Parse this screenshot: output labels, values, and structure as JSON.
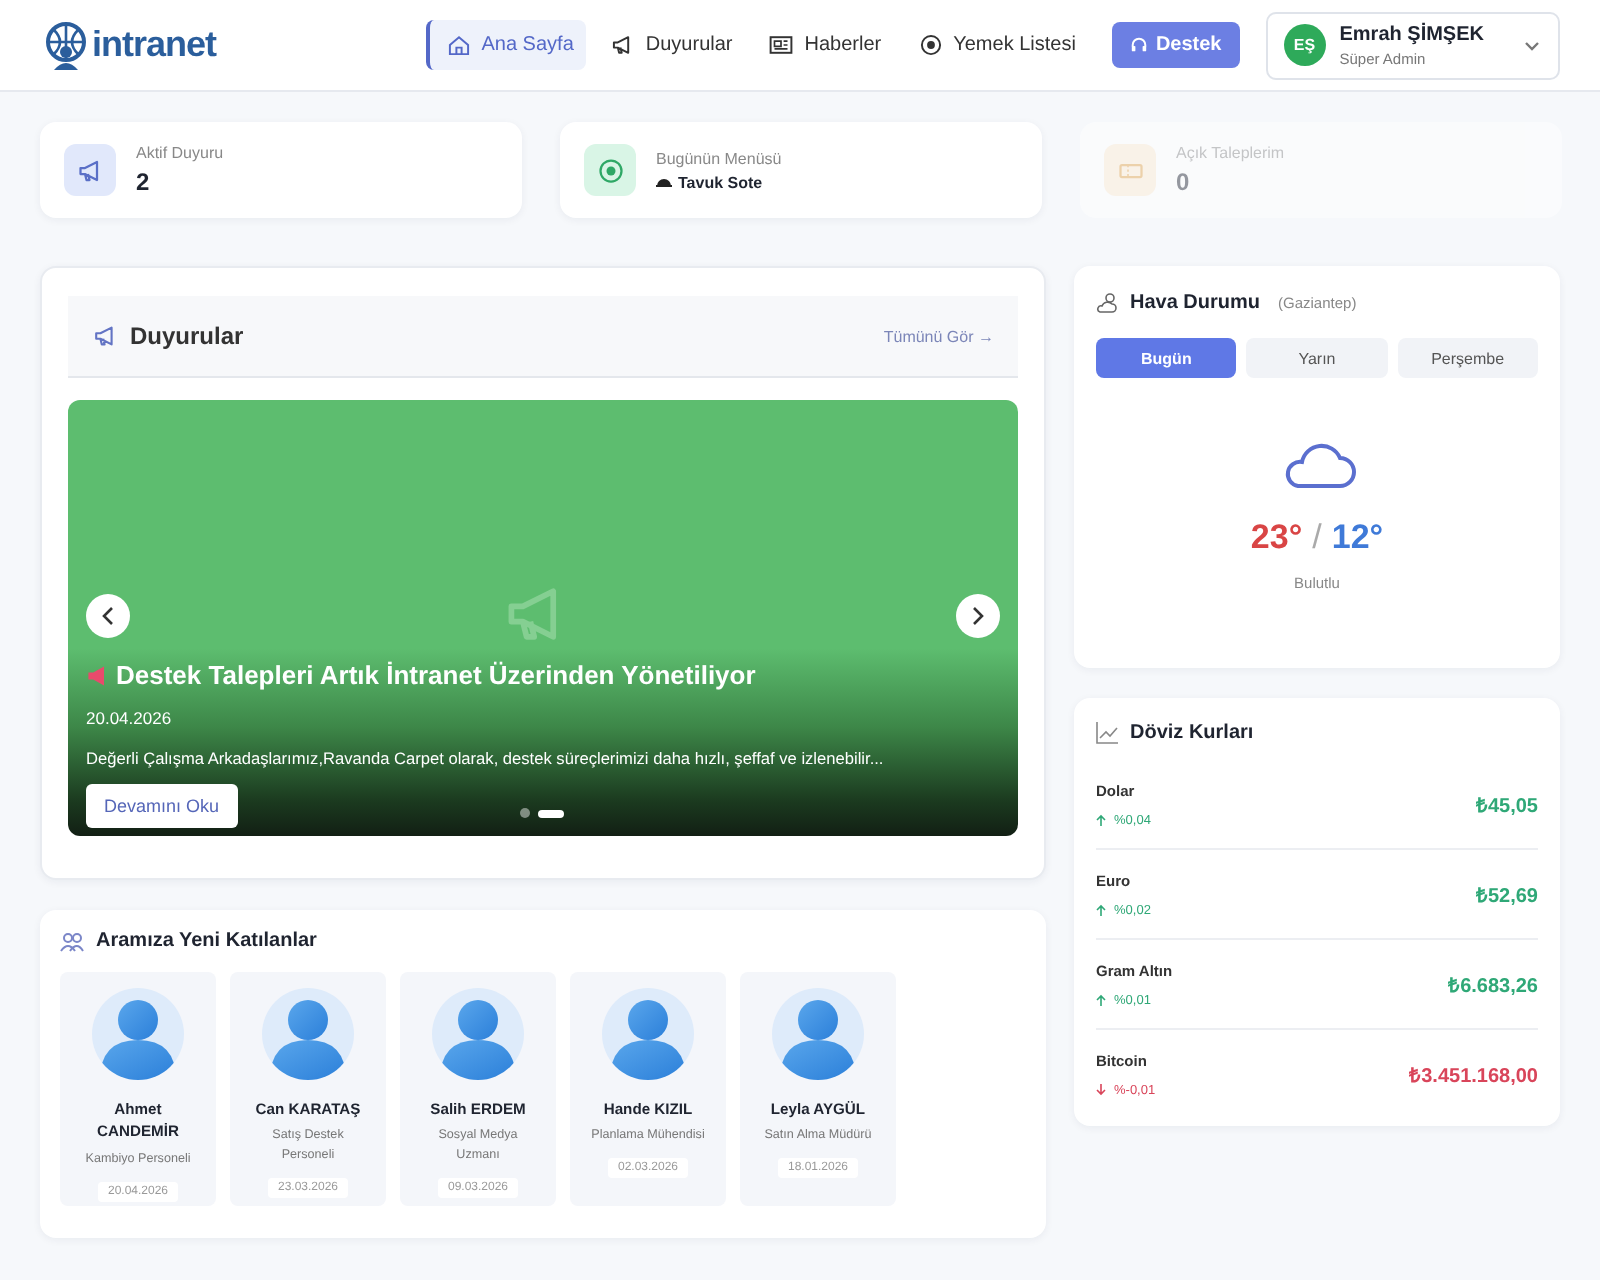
{
  "header": {
    "logo": "intranet",
    "nav": [
      {
        "label": "Ana Sayfa",
        "kind": "home",
        "selected": true
      },
      {
        "label": "Duyurular",
        "kind": "megaphone",
        "selected": false
      },
      {
        "label": "Haberler",
        "kind": "news",
        "selected": false
      },
      {
        "label": "Yemek Listesi",
        "kind": "food",
        "selected": false
      }
    ],
    "support_button": "Destek",
    "user": {
      "initials": "EŞ",
      "name": "Emrah ŞİMŞEK",
      "role": "Süper Admin"
    }
  },
  "stats": [
    {
      "label": "Aktif Duyuru",
      "value": "2",
      "kind": "megaphone",
      "faded": false
    },
    {
      "label": "Bugünün Menüsü",
      "value": "Tavuk Sote",
      "kind": "food",
      "faded": false
    },
    {
      "label": "Açık Taleplerim",
      "value": "0",
      "kind": "ticket",
      "faded": true
    }
  ],
  "announcements": {
    "title": "Duyurular",
    "see_all": "Tümünü Gör →",
    "slide": {
      "title": "Destek Talepleri Artık İntranet Üzerinden Yönetiliyor",
      "date": "20.04.2026",
      "excerpt": "Değerli Çalışma Arkadaşlarımız,Ravanda Carpet olarak, destek süreçlerimizi daha hızlı, şeffaf ve izlenebilir...",
      "button": "Devamını Oku"
    },
    "dots": [
      {
        "selected": false
      },
      {
        "selected": true
      }
    ]
  },
  "new_joiners": {
    "title": "Aramıza Yeni Katılanlar",
    "people": [
      {
        "name": "Ahmet CANDEMİR",
        "role": "Kambiyo Personeli",
        "date": "20.04.2026"
      },
      {
        "name": "Can KARATAŞ",
        "role": "Satış Destek Personeli",
        "date": "23.03.2026"
      },
      {
        "name": "Salih ERDEM",
        "role": "Sosyal Medya Uzmanı",
        "date": "09.03.2026"
      },
      {
        "name": "Hande KIZIL",
        "role": "Planlama Mühendisi",
        "date": "02.03.2026"
      },
      {
        "name": "Leyla AYGÜL",
        "role": "Satın Alma Müdürü",
        "date": "18.01.2026"
      }
    ]
  },
  "weather": {
    "title": "Hava Durumu",
    "city": "(Gaziantep)",
    "tabs": [
      {
        "label": "Bugün",
        "selected": true
      },
      {
        "label": "Yarın",
        "selected": false
      },
      {
        "label": "Perşembe",
        "selected": false
      }
    ],
    "high": "23°",
    "separator": "/",
    "low": "12°",
    "condition": "Bulutlu"
  },
  "currency": {
    "title": "Döviz Kurları",
    "rates": [
      {
        "name": "Dolar",
        "change": "%0,04",
        "price": "₺45,05",
        "kind": "up"
      },
      {
        "name": "Euro",
        "change": "%0,02",
        "price": "₺52,69",
        "kind": "up"
      },
      {
        "name": "Gram Altın",
        "change": "%0,01",
        "price": "₺6.683,26",
        "kind": "up"
      },
      {
        "name": "Bitcoin",
        "change": "%-0,01",
        "price": "₺3.451.168,00",
        "kind": "down"
      }
    ]
  }
}
